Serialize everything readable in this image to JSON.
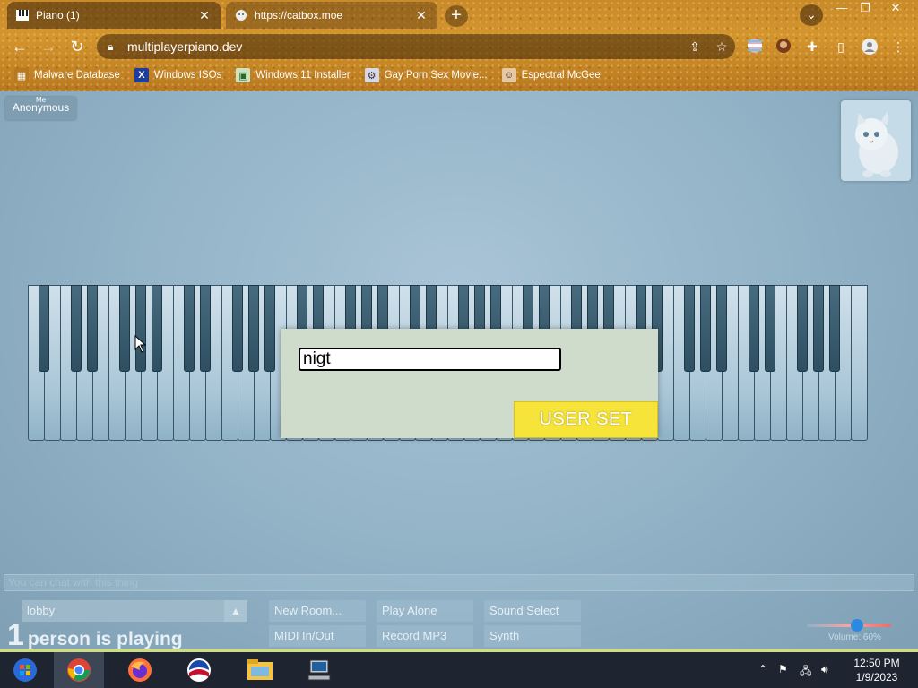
{
  "browser": {
    "tabs": [
      {
        "title": "Piano (1)",
        "icon": "piano-icon"
      },
      {
        "title": "https://catbox.moe",
        "icon": "catbox-icon"
      }
    ],
    "url": "multiplayerpiano.dev",
    "bookmarks": [
      {
        "label": "Malware Database"
      },
      {
        "label": "Windows ISOs"
      },
      {
        "label": "Windows 11 Installer"
      },
      {
        "label": "Gay Porn Sex Movie..."
      },
      {
        "label": "Espectral McGee"
      }
    ]
  },
  "page": {
    "me_badge": {
      "tag": "Me",
      "name": "Anonymous"
    },
    "dialog": {
      "name_value": "nigt",
      "button_label": "USER SET"
    },
    "chat_placeholder": "You can chat with this thing",
    "room": {
      "name": "lobby"
    },
    "players": {
      "count": "1",
      "text": "person is playing"
    },
    "controls": {
      "new_room": "New Room...",
      "play_alone": "Play Alone",
      "sound_select": "Sound Select",
      "midi": "MIDI In/Out",
      "record": "Record MP3",
      "synth": "Synth"
    },
    "volume": {
      "label": "Volume: 60%",
      "level": 0.6
    }
  },
  "taskbar": {
    "apps": [
      "start-button",
      "chrome",
      "firefox",
      "obama-icon",
      "file-explorer",
      "computer-app"
    ],
    "time": "12:50 PM",
    "date": "1/9/2023"
  },
  "colors": {
    "accent_button": "#f7e43a",
    "dialog_bg": "#cfdccc",
    "page_bg": "#8fb0c4"
  }
}
